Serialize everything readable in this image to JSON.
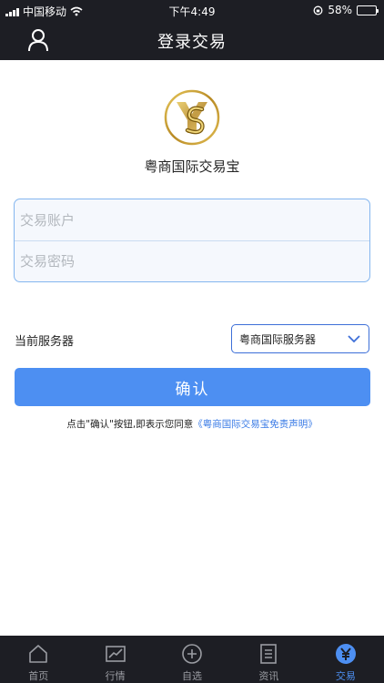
{
  "status_bar": {
    "carrier": "中国移动",
    "time": "下午4:49",
    "battery": "58%",
    "battery_level": 0.58
  },
  "nav": {
    "title": "登录交易"
  },
  "brand": {
    "name": "粤商国际交易宝"
  },
  "form": {
    "account_placeholder": "交易账户",
    "password_placeholder": "交易密码"
  },
  "server": {
    "label": "当前服务器",
    "selected": "粤商国际服务器"
  },
  "confirm_label": "确认",
  "agreement": {
    "text": "点击\"确认\"按钮,即表示您同意",
    "link": "《粤商国际交易宝免责声明》"
  },
  "tabs": [
    {
      "label": "首页",
      "icon": "home-icon"
    },
    {
      "label": "行情",
      "icon": "chart-icon"
    },
    {
      "label": "自选",
      "icon": "add-circle-icon"
    },
    {
      "label": "资讯",
      "icon": "news-icon"
    },
    {
      "label": "交易",
      "icon": "trade-icon",
      "active": true
    }
  ],
  "colors": {
    "bar_bg": "#1d1e24",
    "accent": "#4d8ff2",
    "gold": "#c9a13b"
  }
}
